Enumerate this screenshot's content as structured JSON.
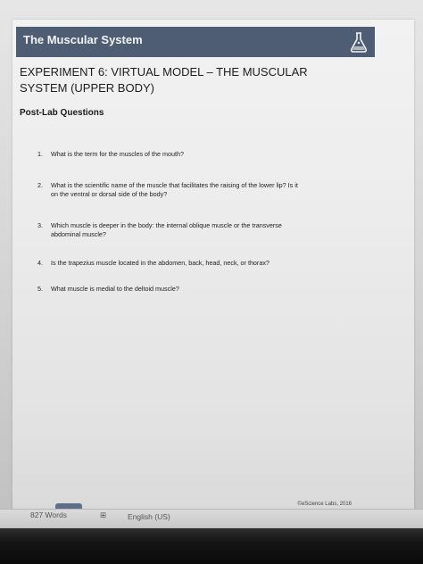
{
  "header": {
    "title": "The Muscular System",
    "icon": "flask-icon"
  },
  "experiment_title_line1": "EXPERIMENT 6: VIRTUAL MODEL – THE MUSCULAR",
  "experiment_title_line2": "SYSTEM (UPPER BODY)",
  "section_heading": "Post-Lab Questions",
  "questions": [
    {
      "num": "1.",
      "line1": "What is the term for the muscles of the mouth?",
      "line2": ""
    },
    {
      "num": "2.",
      "line1": "What is the scientific name of the muscle that facilitates the raising of the lower lip? Is it",
      "line2": "on the ventral or dorsal side of the body?"
    },
    {
      "num": "3.",
      "line1": "Which muscle is deeper in the body: the internal oblique muscle or the transverse",
      "line2": "abdominal muscle?"
    },
    {
      "num": "4.",
      "line1": "Is the trapezius muscle located in the abdomen, back, head, neck, or thorax?",
      "line2": ""
    },
    {
      "num": "5.",
      "line1": "What muscle is medial to the deltoid muscle?",
      "line2": ""
    }
  ],
  "footer_credit": "©eScience Labs, 2016",
  "status": {
    "word_count": "827 Words",
    "proof_icon_glyph": "⊞",
    "language": "English (US)"
  },
  "colors": {
    "header_bar": "#4f5d74",
    "header_text": "#f3f3f3"
  }
}
